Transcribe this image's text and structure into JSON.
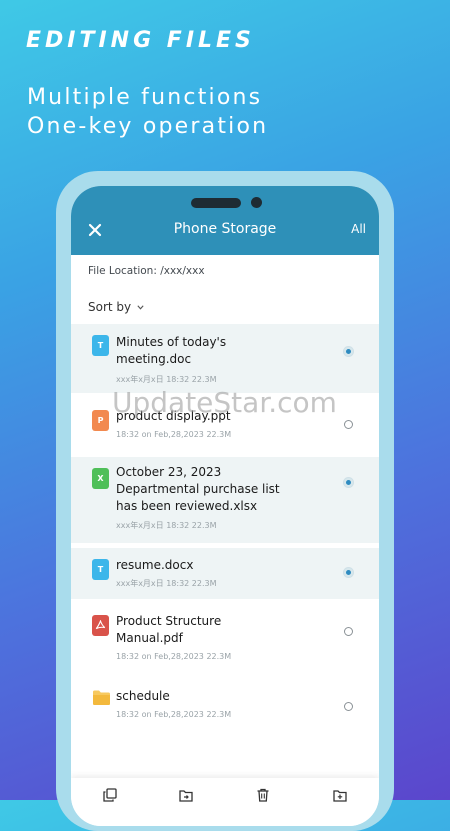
{
  "promo": {
    "title": "EDITING FILES",
    "line1": "Multiple functions",
    "line2": "One-key operation"
  },
  "header": {
    "title": "Phone Storage",
    "all_label": "All",
    "close_icon": "close-icon"
  },
  "location": {
    "label": "File Location:",
    "path": "/xxx/xxx"
  },
  "sort": {
    "label": "Sort by",
    "icon": "chevron-down-icon"
  },
  "files": [
    {
      "name_lines": [
        "Minutes of today's",
        "meeting.doc"
      ],
      "meta": "xxx年x月x日  18:32  22.3M",
      "type": "doc",
      "icon_letter": "T",
      "icon_color": "#3cb6ea",
      "selected": true
    },
    {
      "name_lines": [
        "product display.ppt"
      ],
      "meta": "18:32 on Feb,28,2023  22.3M",
      "type": "ppt",
      "icon_letter": "P",
      "icon_color": "#f2894f",
      "selected": false
    },
    {
      "name_lines": [
        "October 23, 2023",
        "Departmental purchase list",
        "has been reviewed.xlsx"
      ],
      "meta": "xxx年x月x日  18:32  22.3M",
      "type": "xlsx",
      "icon_letter": "X",
      "icon_color": "#4fbf59",
      "selected": true
    },
    {
      "name_lines": [
        "resume.docx"
      ],
      "meta": "xxx年x月x日  18:32  22.3M",
      "type": "doc",
      "icon_letter": "T",
      "icon_color": "#3cb6ea",
      "selected": true
    },
    {
      "name_lines": [
        "Product Structure",
        "Manual.pdf"
      ],
      "meta": "18:32 on Feb,28,2023  22.3M",
      "type": "pdf",
      "icon_letter": "",
      "icon_color": "#d9534a",
      "selected": false
    },
    {
      "name_lines": [
        "schedule"
      ],
      "meta": "18:32 on Feb,28,2023  22.3M",
      "type": "folder",
      "icon_letter": "",
      "icon_color": "#f5c451",
      "selected": false
    }
  ],
  "watermark": "UpdateStar.com",
  "toolbar": {
    "icons": [
      "copy-icon",
      "move-icon",
      "delete-icon",
      "add-file-icon"
    ]
  },
  "colors": {
    "header_bg": "#2e90b8",
    "selected_row_bg": "#eef4f5",
    "radio_checked": "#2e8bc0"
  }
}
